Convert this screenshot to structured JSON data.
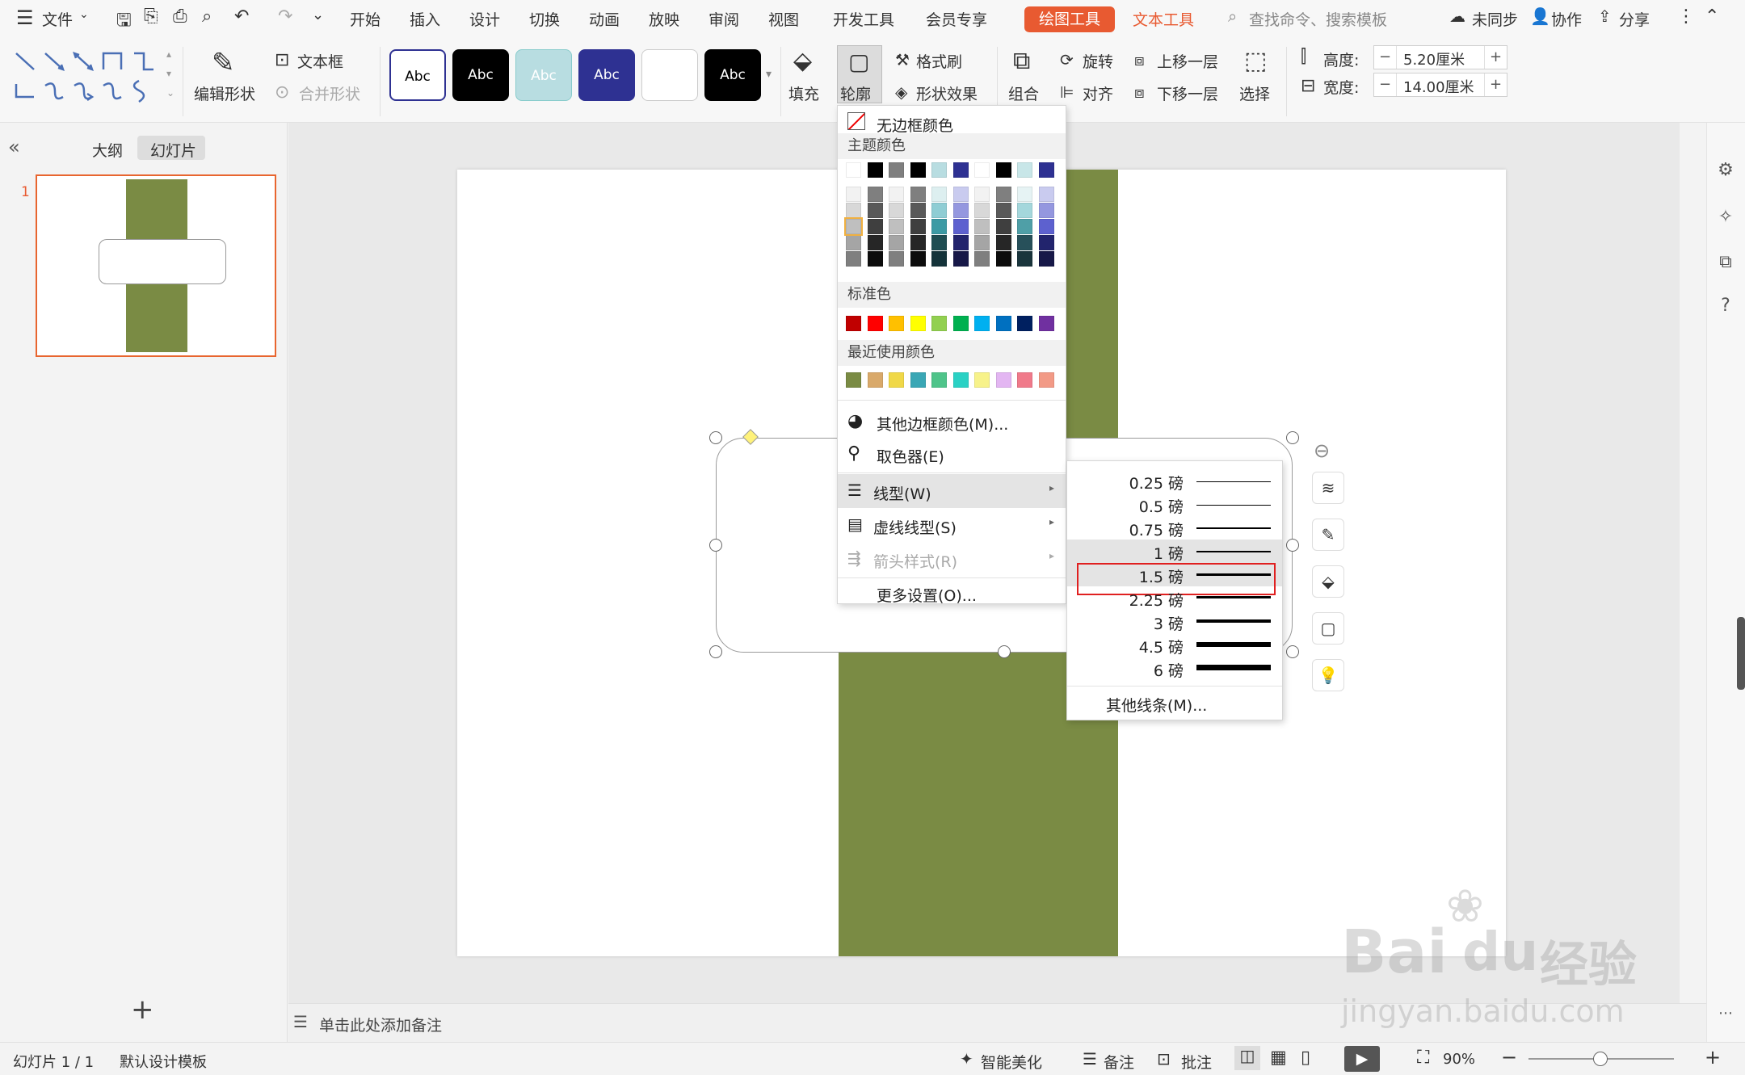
{
  "menubar": {
    "file": "文件",
    "tabs": [
      "开始",
      "插入",
      "设计",
      "切换",
      "动画",
      "放映",
      "审阅",
      "视图",
      "开发工具",
      "会员专享"
    ],
    "drawing_tools": "绘图工具",
    "text_tools": "文本工具",
    "search_placeholder": "查找命令、搜索模板",
    "sync": "未同步",
    "collab": "协作",
    "share": "分享"
  },
  "ribbon": {
    "edit_shape": "编辑形状",
    "textbox": "文本框",
    "merge_shape": "合并形状",
    "style_label": "Abc",
    "fill": "填充",
    "outline": "轮廓",
    "format_brush": "格式刷",
    "shape_effect": "形状效果",
    "group": "组合",
    "rotate": "旋转",
    "align": "对齐",
    "bring_forward": "上移一层",
    "send_backward": "下移一层",
    "select": "选择",
    "height_label": "高度:",
    "height_value": "5.20厘米",
    "width_label": "宽度:",
    "width_value": "14.00厘米"
  },
  "leftpanel": {
    "outline_tab": "大纲",
    "slides_tab": "幻灯片",
    "slide_number": "1"
  },
  "outline_menu": {
    "no_border": "无边框颜色",
    "theme_colors": "主题颜色",
    "standard_colors": "标准色",
    "recent_colors": "最近使用颜色",
    "more_colors": "其他边框颜色(M)...",
    "eyedropper": "取色器(E)",
    "line_style": "线型(W)",
    "dash_style": "虚线线型(S)",
    "arrow_style": "箭头样式(R)",
    "more_settings": "更多设置(O)..."
  },
  "line_weights": {
    "items": [
      "0.25 磅",
      "0.5 磅",
      "0.75 磅",
      "1 磅",
      "1.5 磅",
      "2.25 磅",
      "3 磅",
      "4.5 磅",
      "6 磅"
    ],
    "other": "其他线条(M)...",
    "highlighted": "1.5 磅"
  },
  "colors": {
    "theme_top": [
      "#ffffff",
      "#000000",
      "#7f7f7f",
      "#000000",
      "#b8dde1",
      "#2e3192",
      "#ffffff",
      "#000000",
      "#c8e6e8",
      "#2e3192"
    ],
    "standard": [
      "#c00000",
      "#ff0000",
      "#ffc000",
      "#ffff00",
      "#92d050",
      "#00b050",
      "#00b0f0",
      "#0070c0",
      "#002060",
      "#7030a0"
    ],
    "recent": [
      "#7a8b44",
      "#d9a96a",
      "#f0d848",
      "#3aa7b5",
      "#4fc48a",
      "#2ad1c4",
      "#f7f28a",
      "#e3b6f2",
      "#f07a8a",
      "#f29a86"
    ],
    "accent": "#e85a31",
    "shape_green": "#7a8b44"
  },
  "notes": {
    "placeholder": "单击此处添加备注"
  },
  "status": {
    "slide_info": "幻灯片 1 / 1",
    "template": "默认设计模板",
    "beautify": "智能美化",
    "notes": "备注",
    "comments": "批注",
    "zoom": "90%"
  },
  "watermark": {
    "brand": "Bai",
    "brand2": "du",
    "site": "jingyan.baidu.com",
    "cn": "经验"
  }
}
